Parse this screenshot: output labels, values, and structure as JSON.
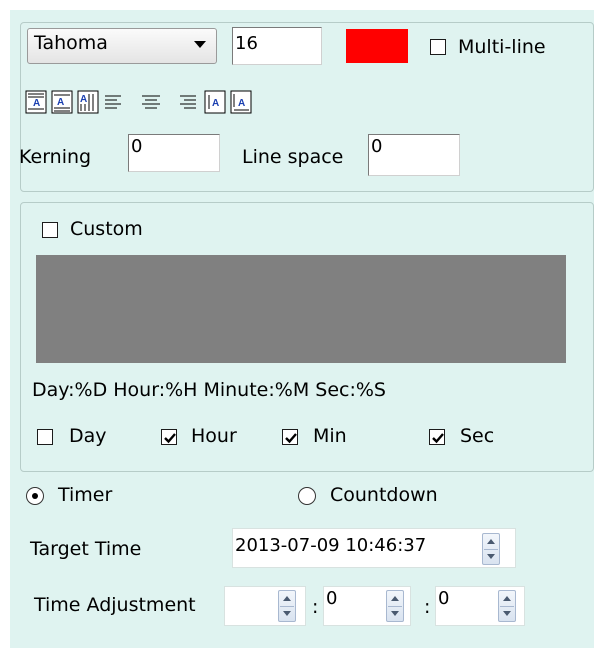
{
  "font": {
    "family": "Tahoma",
    "size": "16",
    "color": "#ff0000",
    "multiline_label": "Multi-line",
    "multiline_checked": false
  },
  "align_icons": [
    "align-justify-top-icon",
    "align-justify-middle-icon",
    "align-vertical-text-icon",
    "align-left-icon",
    "align-center-icon",
    "align-right-icon",
    "align-top-icon",
    "align-bottom-icon"
  ],
  "spacing": {
    "kerning_label": "Kerning",
    "kerning_value": "0",
    "line_space_label": "Line space",
    "line_space_value": "0"
  },
  "custom": {
    "label": "Custom",
    "checked": false,
    "preview_color": "#808080",
    "format_text": "Day:%D Hour:%H Minute:%M Sec:%S"
  },
  "units": {
    "day_label": "Day",
    "day_checked": false,
    "hour_label": "Hour",
    "hour_checked": true,
    "min_label": "Min",
    "min_checked": true,
    "sec_label": "Sec",
    "sec_checked": true
  },
  "mode": {
    "timer_label": "Timer",
    "countdown_label": "Countdown",
    "selected": "Timer"
  },
  "target": {
    "label": "Target Time",
    "value": "2013-07-09 10:46:37"
  },
  "adjustment": {
    "label": "Time Adjustment",
    "hours": "",
    "separator1": ":",
    "minutes": "0",
    "separator2": ":",
    "seconds": "0"
  }
}
